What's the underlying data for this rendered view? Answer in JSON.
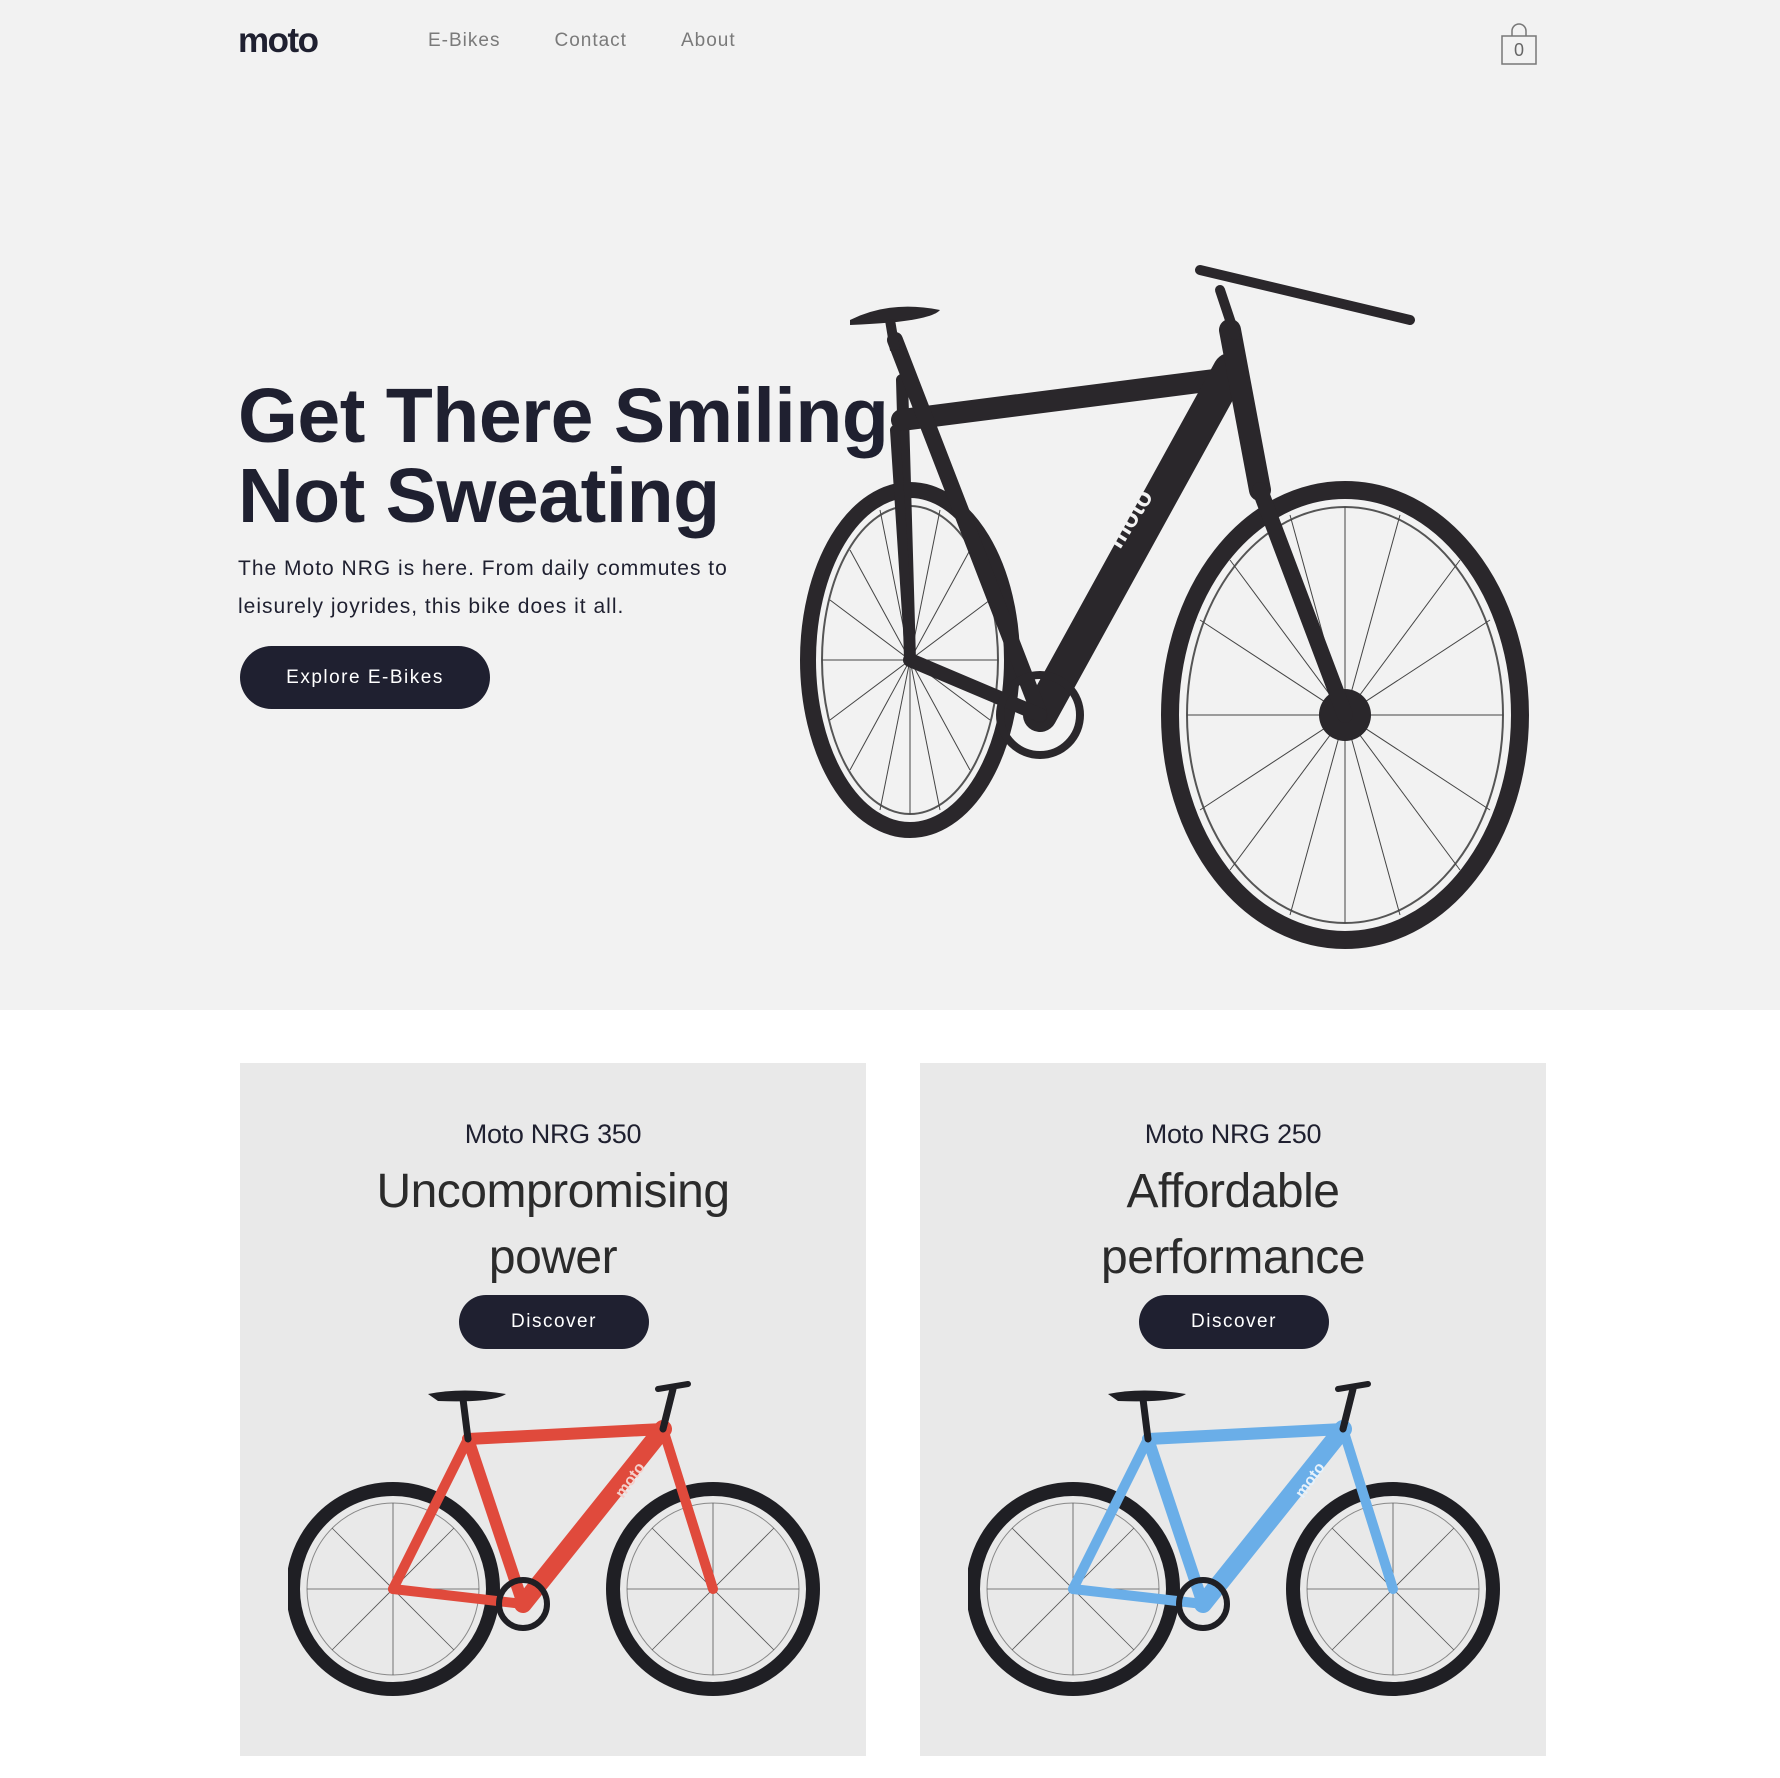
{
  "header": {
    "logo_text": "moto",
    "nav": [
      "E-Bikes",
      "Contact",
      "About"
    ],
    "cart_count": "0"
  },
  "hero": {
    "title_line1": "Get There Smiling",
    "title_line2": "Not Sweating",
    "subtitle_line1": "The Moto NRG is here. From daily commutes to",
    "subtitle_line2": "leisurely joyrides, this bike does it all.",
    "cta_label": "Explore E-Bikes",
    "bike_color": "#2a272b",
    "frame_logo": "moto"
  },
  "products": [
    {
      "model": "Moto NRG 350",
      "tagline_line1": "Uncompromising",
      "tagline_line2": "power",
      "button_label": "Discover",
      "frame_color": "#e04a3c",
      "frame_logo": "moto"
    },
    {
      "model": "Moto NRG 250",
      "tagline_line1": "Affordable",
      "tagline_line2": "performance",
      "button_label": "Discover",
      "frame_color": "#6aaee8",
      "frame_logo": "moto"
    }
  ],
  "colors": {
    "ink": "#1f2030",
    "hero_bg": "#f2f2f2",
    "card_bg": "#e9e9e9"
  },
  "icons": [
    "cart-icon",
    "bike-image"
  ]
}
